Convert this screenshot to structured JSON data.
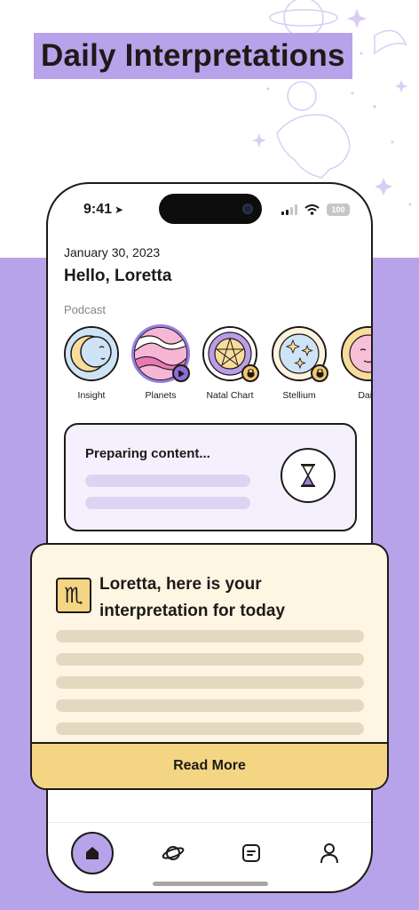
{
  "headline": "Daily Interpretations",
  "status_bar": {
    "time": "9:41",
    "battery": "100"
  },
  "home": {
    "date": "January 30, 2023",
    "greeting": "Hello, Loretta",
    "podcast_label": "Podcast",
    "stories": [
      {
        "label": "Insight",
        "state": "none"
      },
      {
        "label": "Planets",
        "state": "playing"
      },
      {
        "label": "Natal Chart",
        "state": "locked"
      },
      {
        "label": "Stellium",
        "state": "locked"
      },
      {
        "label": "Daily",
        "state": "none"
      }
    ],
    "preparing": {
      "title": "Preparing content..."
    }
  },
  "interpretation": {
    "sign": "♏",
    "title": "Loretta, here is your interpretation for today",
    "read_more": "Read More"
  },
  "tabbar": {
    "tabs": [
      {
        "name": "home",
        "icon": "home-icon",
        "active": true
      },
      {
        "name": "planets",
        "icon": "planet-icon",
        "active": false
      },
      {
        "name": "notes",
        "icon": "note-icon",
        "active": false
      },
      {
        "name": "profile",
        "icon": "profile-icon",
        "active": false
      }
    ]
  },
  "colors": {
    "accent_purple": "#b7a3ea",
    "card_lavender": "#f5f0fe",
    "card_cream": "#fef5e3",
    "button_yellow": "#f4d584",
    "ink": "#1d1a17"
  }
}
